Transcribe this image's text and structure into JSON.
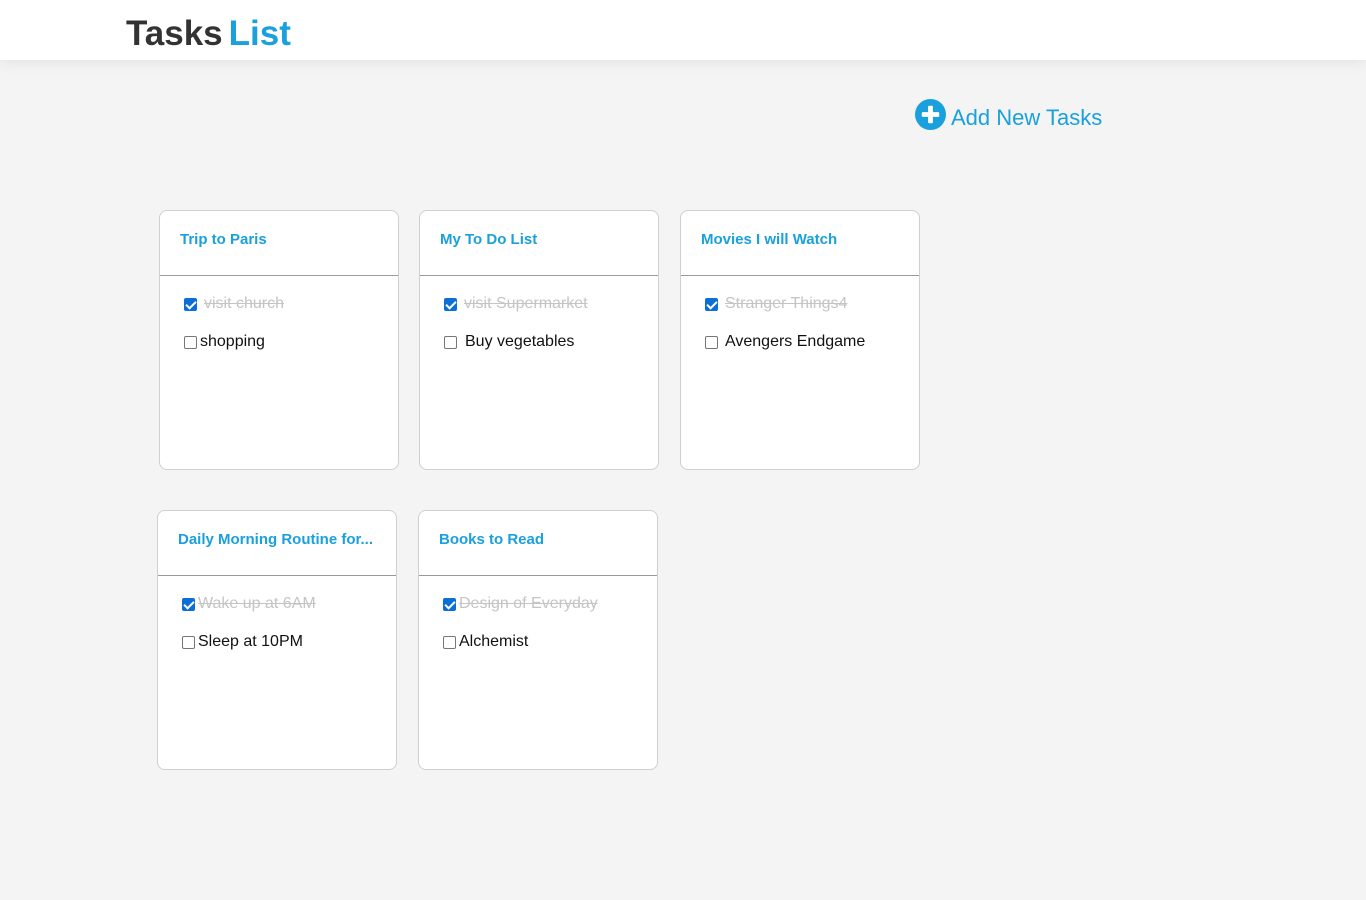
{
  "header": {
    "title_part1": "Tasks",
    "title_part2": "List",
    "brand_color": "#1aa0dc"
  },
  "toolbar": {
    "add_label": "Add New Tasks",
    "add_icon": "plus-circle-icon"
  },
  "lists": [
    {
      "title": "Trip to Paris",
      "tasks": [
        {
          "text": "visit church",
          "done": true
        },
        {
          "text": "shopping",
          "done": false
        }
      ]
    },
    {
      "title": "My To Do List",
      "tasks": [
        {
          "text": "visit Supermarket",
          "done": true
        },
        {
          "text": "Buy vegetables",
          "done": false
        }
      ]
    },
    {
      "title": "Movies I will Watch",
      "tasks": [
        {
          "text": "Stranger Things4",
          "done": true
        },
        {
          "text": "Avengers Endgame",
          "done": false
        }
      ]
    },
    {
      "title": "Daily Morning Routine for...",
      "tasks": [
        {
          "text": "Wake up at 6AM",
          "done": true
        },
        {
          "text": "Sleep at 10PM",
          "done": false
        }
      ]
    },
    {
      "title": "Books to Read",
      "tasks": [
        {
          "text": "Design of Everyday",
          "done": true
        },
        {
          "text": "Alchemist",
          "done": false
        }
      ]
    }
  ]
}
